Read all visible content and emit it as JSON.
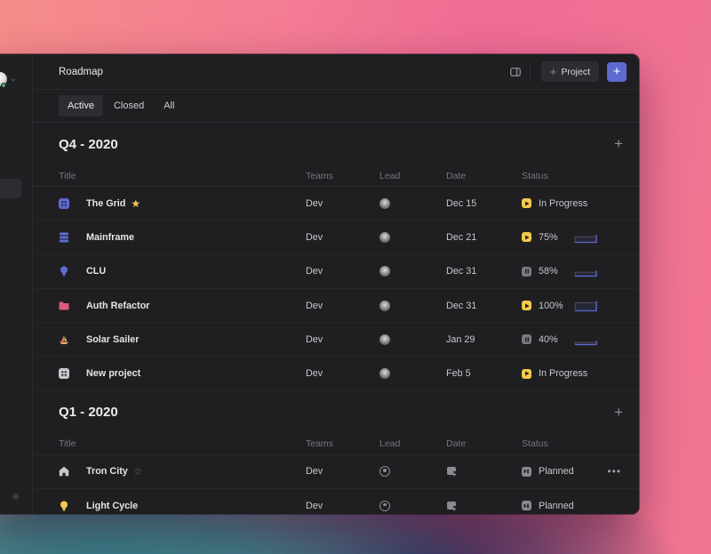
{
  "app": {
    "page_title": "Roadmap",
    "accent_color": "#5e6ad2",
    "header": {
      "panel_toggle_icon": "sidebar-panel-icon",
      "project_button_label": "Project",
      "new_button_icon": "plus-icon"
    },
    "tabs": [
      {
        "label": "Active",
        "active": true
      },
      {
        "label": "Closed",
        "active": false
      },
      {
        "label": "All",
        "active": false
      }
    ]
  },
  "columns": {
    "title": "Title",
    "teams": "Teams",
    "lead": "Lead",
    "date": "Date",
    "status": "Status"
  },
  "sections": [
    {
      "title": "Q4 - 2020",
      "rows": [
        {
          "icon": "grid-icon",
          "icon_color": "#5e6ad2",
          "name": "The Grid",
          "star": "filled",
          "team": "Dev",
          "lead": "avatar",
          "date": "Dec 15",
          "status_icon": "play",
          "status": "In Progress",
          "progress": null
        },
        {
          "icon": "stack-icon",
          "icon_color": "#5e6ad2",
          "name": "Mainframe",
          "star": null,
          "team": "Dev",
          "lead": "avatar",
          "date": "Dec 21",
          "status_icon": "play",
          "status": "75%",
          "progress": 0.75
        },
        {
          "icon": "bulb-icon",
          "icon_color": "#5e6ad2",
          "name": "CLU",
          "star": null,
          "team": "Dev",
          "lead": "avatar",
          "date": "Dec 31",
          "status_icon": "pause",
          "status": "58%",
          "progress": 0.58
        },
        {
          "icon": "folder-icon",
          "icon_color": "#e05a79",
          "name": "Auth Refactor",
          "star": null,
          "team": "Dev",
          "lead": "avatar",
          "date": "Dec 31",
          "status_icon": "play",
          "status": "100%",
          "progress": 1.0
        },
        {
          "icon": "sailboat-icon",
          "icon_color": "#f0a070",
          "name": "Solar Sailer",
          "star": null,
          "team": "Dev",
          "lead": "avatar",
          "date": "Jan 29",
          "status_icon": "pause",
          "status": "40%",
          "progress": 0.4
        },
        {
          "icon": "grid-icon",
          "icon_color": "#c8c8cc",
          "name": "New project",
          "star": null,
          "team": "Dev",
          "lead": "avatar",
          "date": "Feb 5",
          "status_icon": "play",
          "status": "In Progress",
          "progress": null
        }
      ]
    },
    {
      "title": "Q1 - 2020",
      "rows": [
        {
          "icon": "home-icon",
          "icon_color": "#c8c8cc",
          "name": "Tron City",
          "star": "empty",
          "team": "Dev",
          "lead": "empty",
          "date": "",
          "date_icon": "calendar-add-icon",
          "status_icon": "planned",
          "status": "Planned",
          "progress": null,
          "menu": "•••"
        },
        {
          "icon": "bulb-icon",
          "icon_color": "#f2c94c",
          "name": "Light Cycle",
          "star": null,
          "team": "Dev",
          "lead": "empty",
          "date": "",
          "date_icon": "calendar-add-icon",
          "status_icon": "planned",
          "status": "Planned",
          "progress": null
        }
      ]
    }
  ]
}
